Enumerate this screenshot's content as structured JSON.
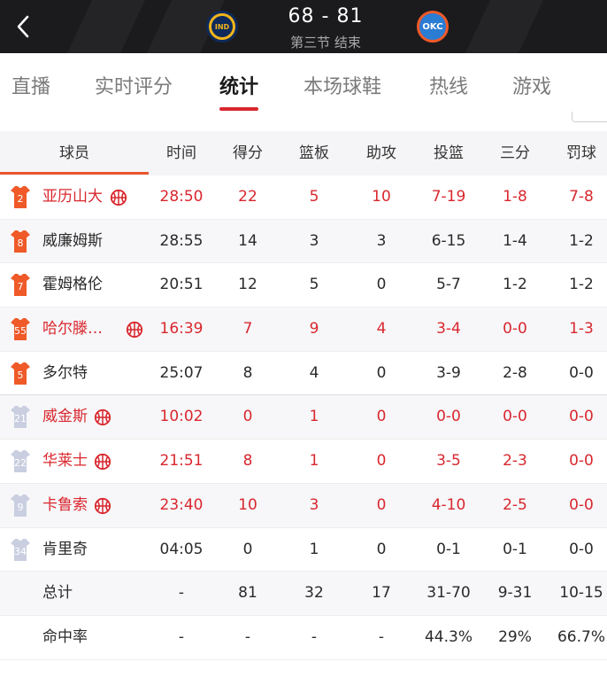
{
  "header": {
    "home_logo": "IND",
    "away_logo": "OKC",
    "score": "68 - 81",
    "period": "第三节 结束",
    "colors": {
      "bg": "#1b1b1d",
      "accent": "#d9272e"
    }
  },
  "tabs": [
    {
      "label": "直播"
    },
    {
      "label": "实时评分"
    },
    {
      "label": "统计"
    },
    {
      "label": "本场球鞋"
    },
    {
      "label": "热线"
    },
    {
      "label": "游戏"
    }
  ],
  "table": {
    "headers": [
      "球员",
      "时间",
      "得分",
      "篮板",
      "助攻",
      "投篮",
      "三分",
      "罚球"
    ],
    "rows": [
      {
        "num": "2",
        "name": "亚历山大",
        "time": "28:50",
        "pts": "22",
        "reb": "5",
        "ast": "10",
        "fg": "7-19",
        "tp": "1-8",
        "ft": "7-8"
      },
      {
        "num": "8",
        "name": "威廉姆斯",
        "time": "28:55",
        "pts": "14",
        "reb": "3",
        "ast": "3",
        "fg": "6-15",
        "tp": "1-4",
        "ft": "1-2"
      },
      {
        "num": "7",
        "name": "霍姆格伦",
        "time": "20:51",
        "pts": "12",
        "reb": "5",
        "ast": "0",
        "fg": "5-7",
        "tp": "1-2",
        "ft": "1-2"
      },
      {
        "num": "55",
        "name": "哈尔滕…",
        "time": "16:39",
        "pts": "7",
        "reb": "9",
        "ast": "4",
        "fg": "3-4",
        "tp": "0-0",
        "ft": "1-3"
      },
      {
        "num": "5",
        "name": "多尔特",
        "time": "25:07",
        "pts": "8",
        "reb": "4",
        "ast": "0",
        "fg": "3-9",
        "tp": "2-8",
        "ft": "0-0"
      },
      {
        "num": "21",
        "name": "威金斯",
        "time": "10:02",
        "pts": "0",
        "reb": "1",
        "ast": "0",
        "fg": "0-0",
        "tp": "0-0",
        "ft": "0-0"
      },
      {
        "num": "22",
        "name": "华莱士",
        "time": "21:51",
        "pts": "8",
        "reb": "1",
        "ast": "0",
        "fg": "3-5",
        "tp": "2-3",
        "ft": "0-0"
      },
      {
        "num": "9",
        "name": "卡鲁索",
        "time": "23:40",
        "pts": "10",
        "reb": "3",
        "ast": "0",
        "fg": "4-10",
        "tp": "2-5",
        "ft": "0-0"
      },
      {
        "num": "34",
        "name": "肯里奇",
        "time": "04:05",
        "pts": "0",
        "reb": "1",
        "ast": "0",
        "fg": "0-1",
        "tp": "0-1",
        "ft": "0-0"
      },
      {
        "num": "",
        "name": "总计",
        "time": "-",
        "pts": "81",
        "reb": "32",
        "ast": "17",
        "fg": "31-70",
        "tp": "9-31",
        "ft": "10-15"
      },
      {
        "num": "",
        "name": "命中率",
        "time": "-",
        "pts": "-",
        "reb": "-",
        "ast": "-",
        "fg": "44.3%",
        "tp": "29%",
        "ft": "66.7%"
      }
    ]
  }
}
